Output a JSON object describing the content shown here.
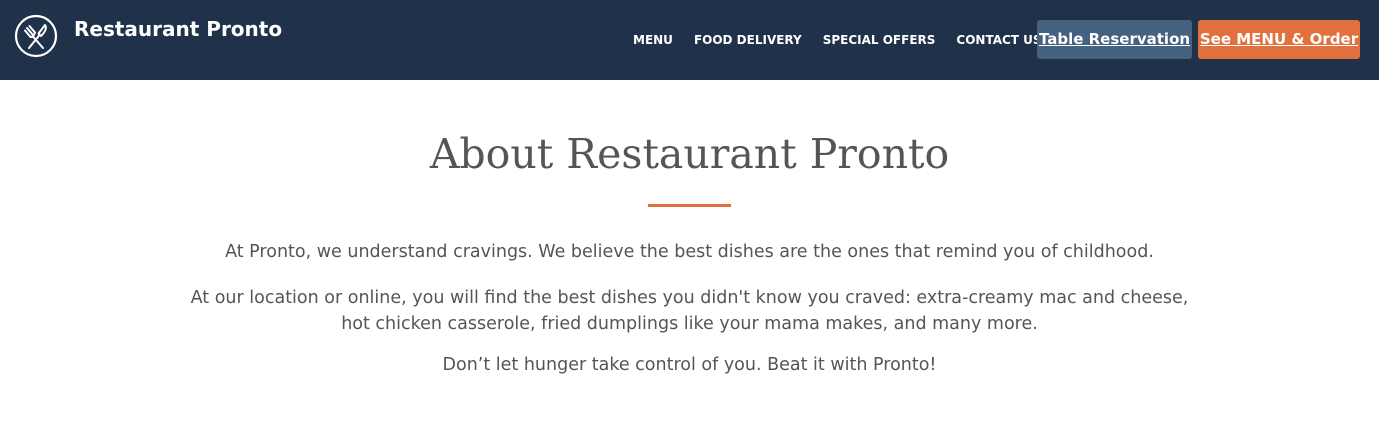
{
  "header": {
    "brand_name": "Restaurant Pronto",
    "logo_icon": "fork-knife-icon",
    "nav": [
      {
        "label": "MENU"
      },
      {
        "label": "FOOD DELIVERY"
      },
      {
        "label": "SPECIAL OFFERS"
      },
      {
        "label": "CONTACT US"
      }
    ],
    "reserve_button": "Table Reservation",
    "order_button": "See MENU & Order"
  },
  "main": {
    "title": "About Restaurant Pronto",
    "paragraphs": [
      "At Pronto, we understand cravings. We believe the best dishes are the ones that remind you of childhood.",
      "At our location or online, you will find the best dishes you didn't know you craved: extra-creamy mac and cheese, hot chicken casserole, fried dumplings like your mama makes, and many more.",
      "Don’t let hunger take control of you. Beat it with Pronto!"
    ]
  },
  "colors": {
    "navbar_bg": "#1f3249",
    "reserve_button_bg": "#44617f",
    "order_button_bg": "#e2703d",
    "accent_divider": "#e2703d",
    "body_text": "#555555"
  }
}
